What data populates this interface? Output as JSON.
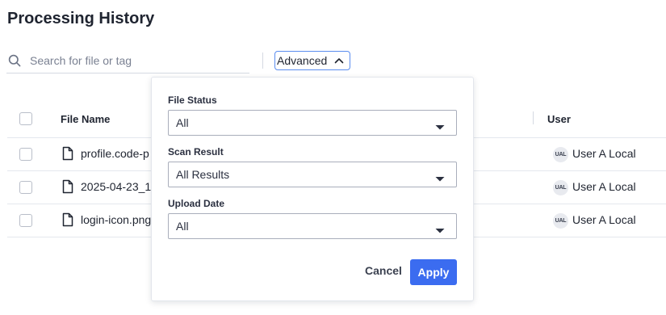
{
  "page": {
    "title": "Processing History"
  },
  "search": {
    "placeholder": "Search for file or tag",
    "value": ""
  },
  "advanced": {
    "label": "Advanced",
    "expanded": true
  },
  "table": {
    "columns": {
      "file_name": "File Name",
      "user": "User"
    },
    "rows": [
      {
        "file_name": "profile.code-p",
        "user_initials": "UAL",
        "user_name": "User A Local"
      },
      {
        "file_name": "2025-04-23_1",
        "user_initials": "UAL",
        "user_name": "User A Local"
      },
      {
        "file_name": "login-icon.png",
        "user_initials": "UAL",
        "user_name": "User A Local"
      }
    ]
  },
  "filters": {
    "file_status": {
      "label": "File Status",
      "value": "All"
    },
    "scan_result": {
      "label": "Scan Result",
      "value": "All Results"
    },
    "upload_date": {
      "label": "Upload Date",
      "value": "All"
    },
    "cancel_label": "Cancel",
    "apply_label": "Apply"
  },
  "colors": {
    "accent": "#3b6cf0",
    "border_focus": "#5b8def",
    "text": "#1f2430"
  },
  "icons": {
    "search": "search-icon",
    "chevron": "chevron-up-icon",
    "file": "file-icon",
    "caret": "caret-down-icon"
  }
}
